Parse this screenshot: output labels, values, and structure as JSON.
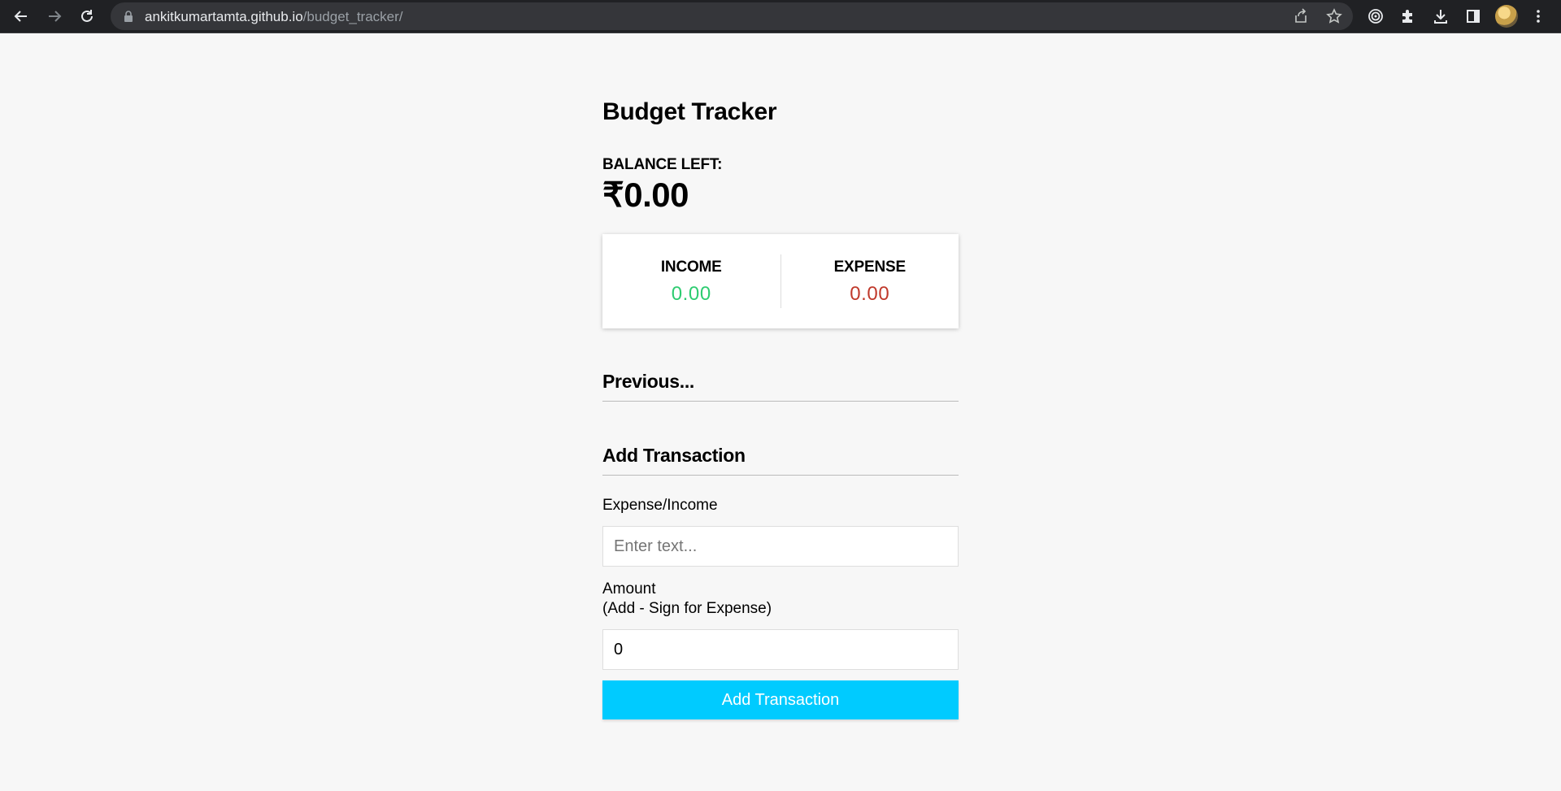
{
  "browser": {
    "url_host": "ankitkumartamta.github.io",
    "url_path": "/budget_tracker/",
    "icons": [
      "back-icon",
      "forward-icon",
      "reload-icon",
      "lock-icon",
      "share-icon",
      "star-icon",
      "extension-target-icon",
      "puzzle-icon",
      "download-icon",
      "side-panel-icon",
      "avatar",
      "kebab-menu-icon"
    ]
  },
  "app": {
    "title": "Budget Tracker",
    "balance_label": "BALANCE LEFT:",
    "balance_value": "₹0.00",
    "income_label": "INCOME",
    "income_value": "0.00",
    "expense_label": "EXPENSE",
    "expense_value": "0.00",
    "history_heading": "Previous...",
    "add_heading": "Add Transaction",
    "text_label": "Expense/Income",
    "text_placeholder": "Enter text...",
    "text_value": "",
    "amount_label_line1": "Amount",
    "amount_label_line2": "(Add - Sign for Expense)",
    "amount_value": "0",
    "submit_label": "Add Transaction",
    "colors": {
      "income": "#2ecc71",
      "expense": "#c0392b",
      "button": "#00cbff"
    }
  }
}
